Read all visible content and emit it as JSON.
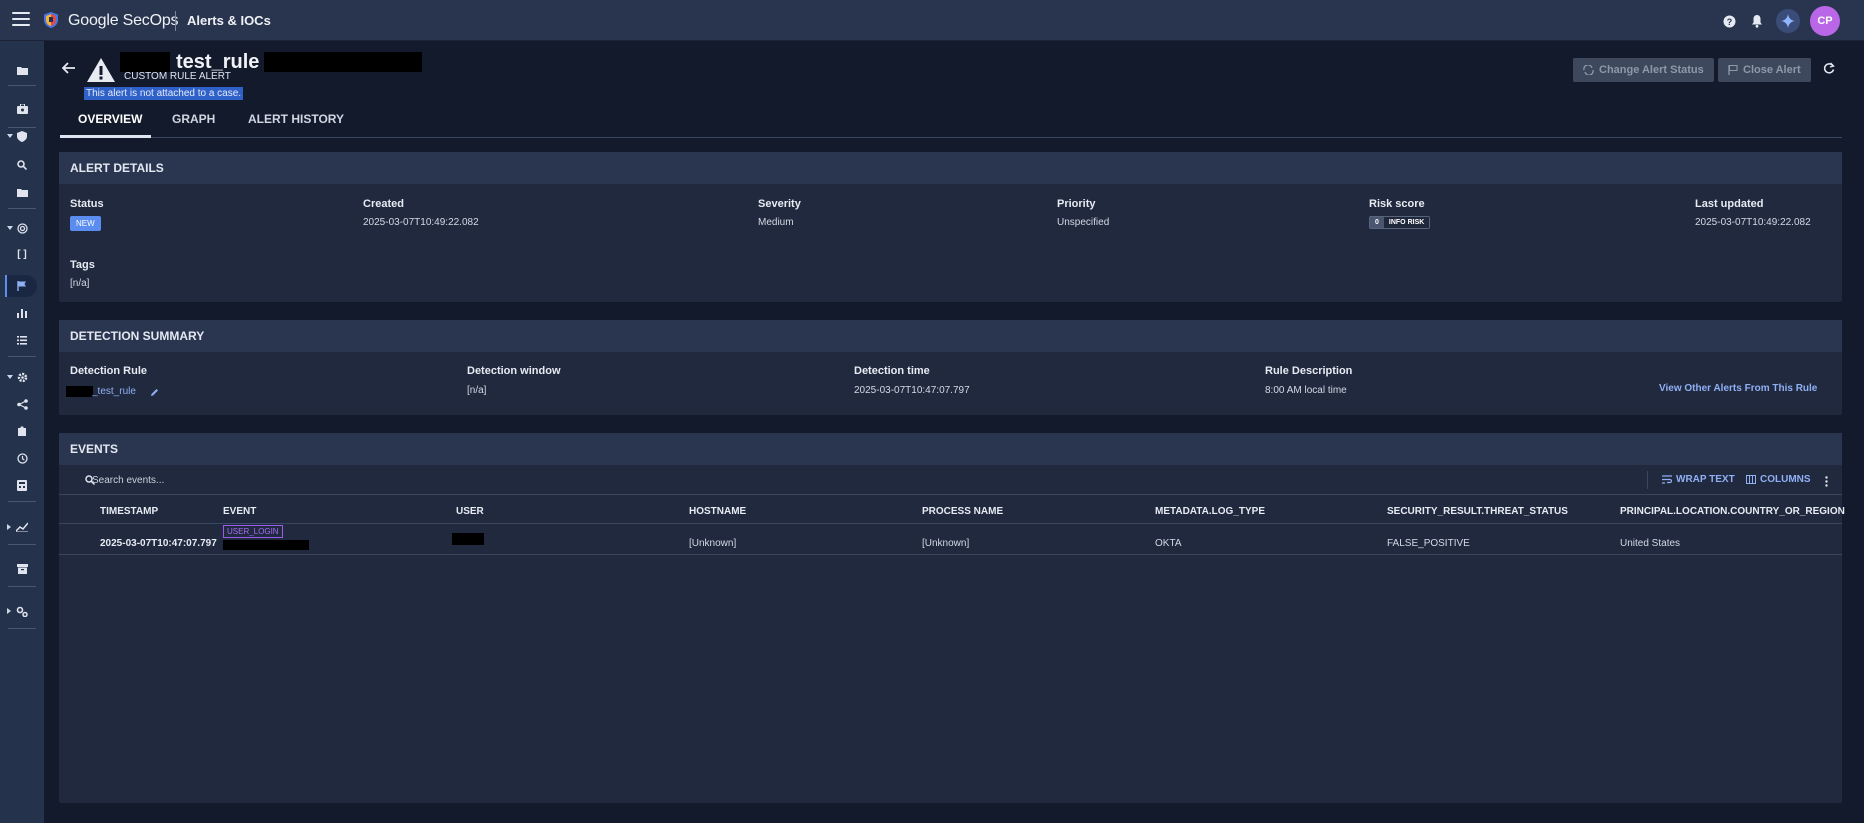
{
  "app": {
    "brand": "Google SecOps",
    "page": "Alerts & IOCs",
    "avatar_initials": "CP"
  },
  "alert": {
    "title": "test_rule -",
    "subtitle": "CUSTOM RULE ALERT",
    "notice": "This alert is not attached to a case.",
    "actions": {
      "change_status": "Change Alert Status",
      "close": "Close Alert"
    }
  },
  "tabs": [
    "OVERVIEW",
    "GRAPH",
    "ALERT HISTORY"
  ],
  "alert_details": {
    "heading": "ALERT DETAILS",
    "status_label": "Status",
    "status_value": "NEW",
    "created_label": "Created",
    "created_value": "2025-03-07T10:49:22.082",
    "severity_label": "Severity",
    "severity_value": "Medium",
    "priority_label": "Priority",
    "priority_value": "Unspecified",
    "risk_label": "Risk score",
    "risk_value": "0",
    "risk_text": "INFO RISK",
    "updated_label": "Last updated",
    "updated_value": "2025-03-07T10:49:22.082",
    "tags_label": "Tags",
    "tags_value": "[n/a]"
  },
  "detection_summary": {
    "heading": "DETECTION SUMMARY",
    "rule_label": "Detection Rule",
    "rule_value": "_test_rule",
    "window_label": "Detection window",
    "window_value": "[n/a]",
    "time_label": "Detection time",
    "time_value": "2025-03-07T10:47:07.797",
    "desc_label": "Rule Description",
    "desc_value": "8:00 AM local time",
    "view_other": "View Other Alerts From This Rule"
  },
  "events": {
    "heading": "EVENTS",
    "search_placeholder": "Search events...",
    "wrap_text": "WRAP TEXT",
    "columns": "COLUMNS",
    "headers": [
      "TIMESTAMP",
      "EVENT",
      "USER",
      "HOSTNAME",
      "PROCESS NAME",
      "METADATA.LOG_TYPE",
      "SECURITY_RESULT.THREAT_STATUS",
      "PRINCIPAL.LOCATION.COUNTRY_OR_REGION"
    ],
    "rows": [
      {
        "timestamp": "2025-03-07T10:47:07.797",
        "event": "USER_LOGIN",
        "hostname": "[Unknown]",
        "process": "[Unknown]",
        "log_type": "OKTA",
        "threat_status": "FALSE_POSITIVE",
        "country": "United States"
      }
    ]
  },
  "colors": {
    "accent": "#5b8cf0",
    "background": "#131a2b",
    "panel": "#21293f",
    "event_tag": "#9a5cf0",
    "avatar": "#b967e6"
  }
}
